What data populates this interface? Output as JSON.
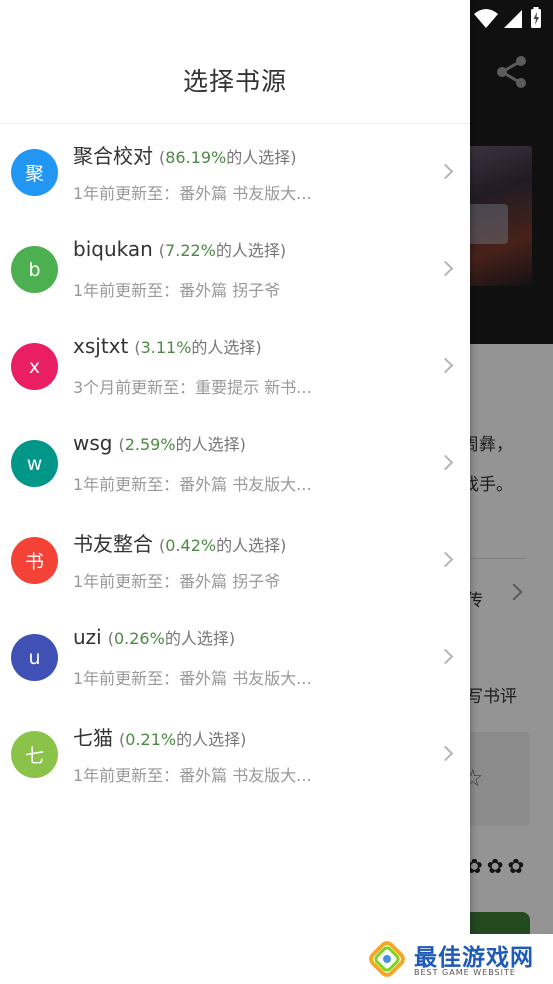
{
  "drawer": {
    "title": "选择书源",
    "sources": [
      {
        "avatar": "聚",
        "color": "#2196f3",
        "name": "聚合校对",
        "pct_open": "(",
        "pct": "86.19%",
        "pct_suffix": "的人选择)",
        "update": "1年前更新至：番外篇 书友版大..."
      },
      {
        "avatar": "b",
        "color": "#4caf50",
        "name": "biqukan",
        "pct_open": "(",
        "pct": "7.22%",
        "pct_suffix": "的人选择)",
        "update": "1年前更新至：番外篇 拐子爷"
      },
      {
        "avatar": "x",
        "color": "#e91e63",
        "name": "xsjtxt",
        "pct_open": "(",
        "pct": "3.11%",
        "pct_suffix": "的人选择)",
        "update": "3个月前更新至：重要提示 新书..."
      },
      {
        "avatar": "w",
        "color": "#009688",
        "name": "wsg",
        "pct_open": "(",
        "pct": "2.59%",
        "pct_suffix": "的人选择)",
        "update": "1年前更新至：番外篇 书友版大..."
      },
      {
        "avatar": "书",
        "color": "#f44336",
        "name": "书友整合",
        "pct_open": "(",
        "pct": "0.42%",
        "pct_suffix": "的人选择)",
        "update": "1年前更新至：番外篇 拐子爷"
      },
      {
        "avatar": "u",
        "color": "#3f51b5",
        "name": "uzi",
        "pct_open": "(",
        "pct": "0.26%",
        "pct_suffix": "的人选择)",
        "update": "1年前更新至：番外篇 书友版大..."
      },
      {
        "avatar": "七",
        "color": "#8bc34a",
        "name": "七猫",
        "pct_open": "(",
        "pct": "0.21%",
        "pct_suffix": "的人选择)",
        "update": "1年前更新至：番外篇 书友版大..."
      }
    ]
  },
  "background": {
    "text_line1": "周彝，",
    "text_line2": "找手。",
    "link_text": "传",
    "write_review": "写书评",
    "stars": "✿✿✿"
  },
  "watermark": {
    "title": "最佳游戏网",
    "subtitle": "BEST GAME WEBSITE"
  },
  "icons": {
    "share": "share-icon",
    "wifi": "wifi-icon",
    "signal": "signal-icon",
    "battery": "battery-charging-icon",
    "chevron": "chevron-right-icon"
  }
}
